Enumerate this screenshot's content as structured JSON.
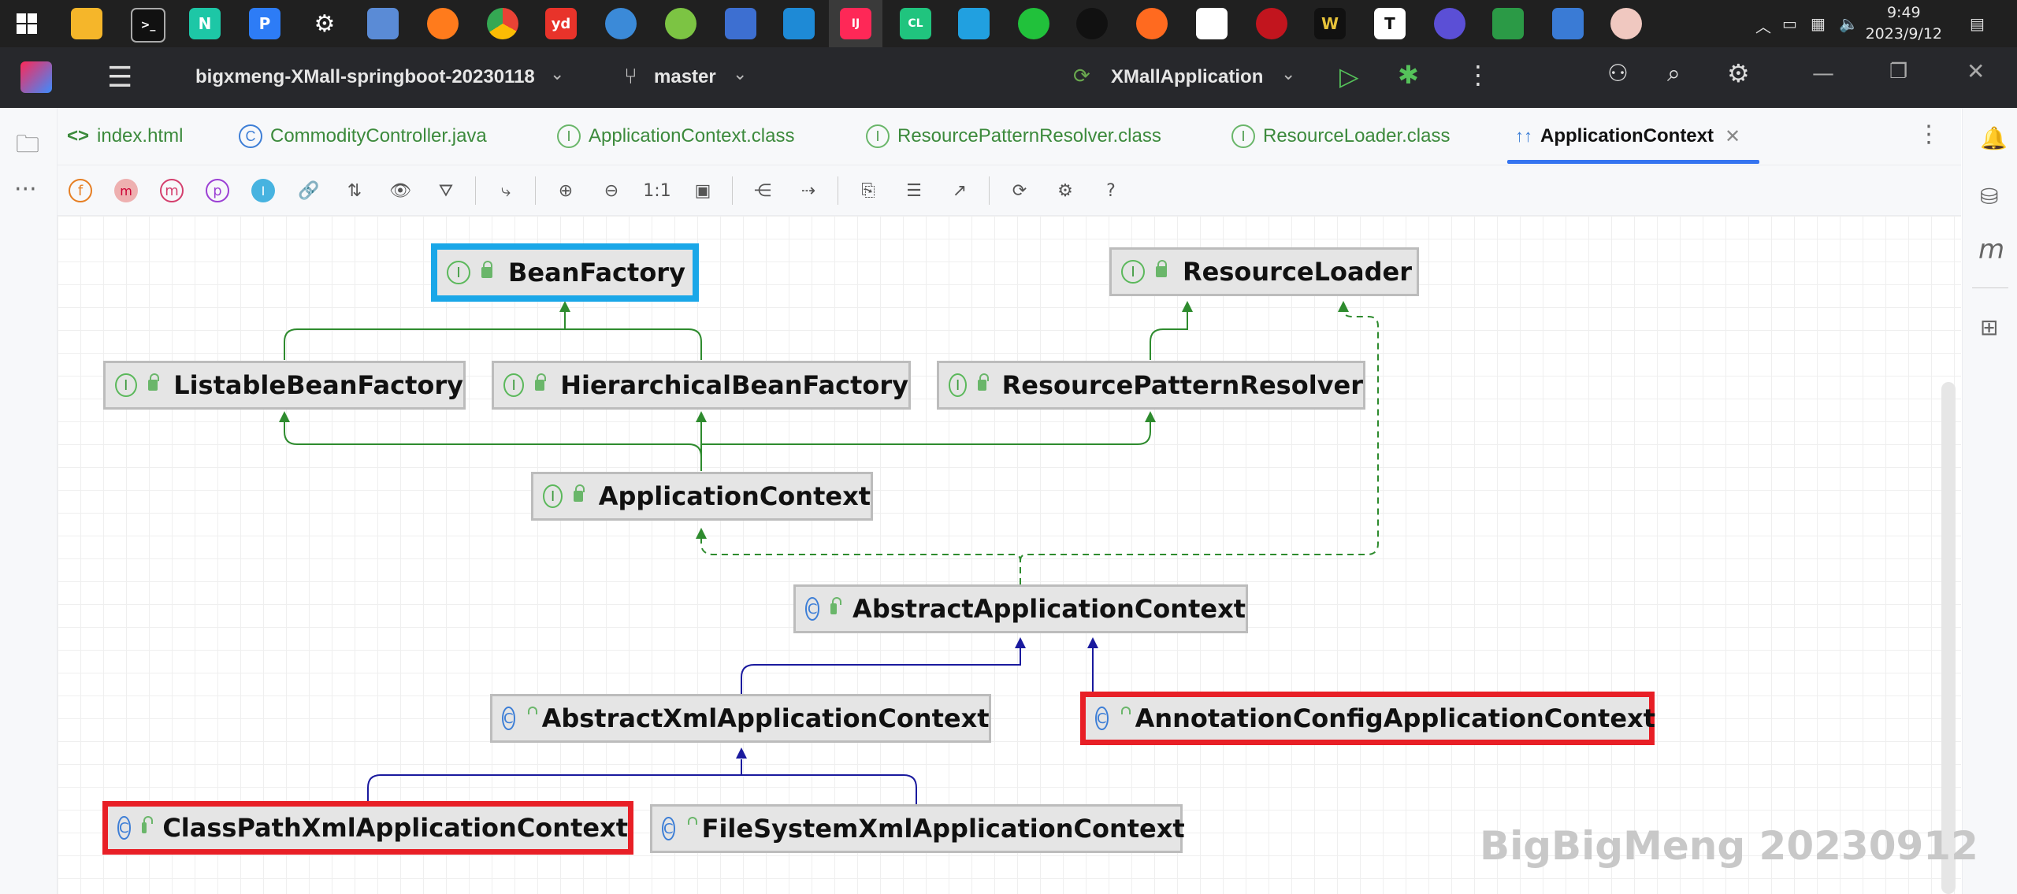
{
  "taskbar": {
    "time": "9:49",
    "date": "2023/9/12",
    "apps": [
      "windows-start",
      "file-explorer",
      "terminal",
      "webstorm",
      "wps-pdf",
      "settings",
      "vmware",
      "firefox",
      "chrome",
      "youdao",
      "net-disk",
      "green-app",
      "calculator",
      "vscode",
      "intellij",
      "clion",
      "other-app",
      "wechat",
      "qq",
      "edit-app",
      "baidu-netdisk",
      "red-app",
      "wps-writer",
      "typora",
      "moon-app",
      "screen-app",
      "remote-desktop",
      "avatar-app"
    ]
  },
  "ide": {
    "project": "bigxmeng-XMall-springboot-20230118",
    "branch": "master",
    "run_config": "XMallApplication"
  },
  "tabs": [
    {
      "label": "index.html",
      "icon": "<>"
    },
    {
      "label": "CommodityController.java",
      "icon": "C"
    },
    {
      "label": "ApplicationContext.class",
      "icon": "I"
    },
    {
      "label": "ResourcePatternResolver.class",
      "icon": "I"
    },
    {
      "label": "ResourceLoader.class",
      "icon": "I"
    },
    {
      "label": "ApplicationContext",
      "icon": "↑↑",
      "active": true
    }
  ],
  "toolbar": {
    "buttons": [
      "f",
      "m",
      "m",
      "p",
      "I",
      "link",
      "sort",
      "eye",
      "filter",
      "route",
      "zoom-in",
      "zoom-out",
      "1:1",
      "fit",
      "layout",
      "arrow",
      "copy",
      "align",
      "export",
      "refresh",
      "settings",
      "?"
    ],
    "actual_size_label": "1:1",
    "help_label": "?"
  },
  "diagram": {
    "nodes": [
      {
        "label": "BeanFactory",
        "kind": "I",
        "highlight": "blue"
      },
      {
        "label": "ResourceLoader",
        "kind": "I"
      },
      {
        "label": "ListableBeanFactory",
        "kind": "I"
      },
      {
        "label": "HierarchicalBeanFactory",
        "kind": "I"
      },
      {
        "label": "ResourcePatternResolver",
        "kind": "I"
      },
      {
        "label": "ApplicationContext",
        "kind": "I"
      },
      {
        "label": "AbstractApplicationContext",
        "kind": "C"
      },
      {
        "label": "AbstractXmlApplicationContext",
        "kind": "C"
      },
      {
        "label": "AnnotationConfigApplicationContext",
        "kind": "C",
        "highlight": "red"
      },
      {
        "label": "ClassPathXmlApplicationContext",
        "kind": "C",
        "highlight": "red"
      },
      {
        "label": "FileSystemXmlApplicationContext",
        "kind": "C"
      }
    ],
    "colors": {
      "extends_interface": "#2e8b2e",
      "extends_class": "#1a1a9e",
      "implements": "#2e8b2e"
    }
  },
  "watermark": "BigBigMeng 20230912"
}
